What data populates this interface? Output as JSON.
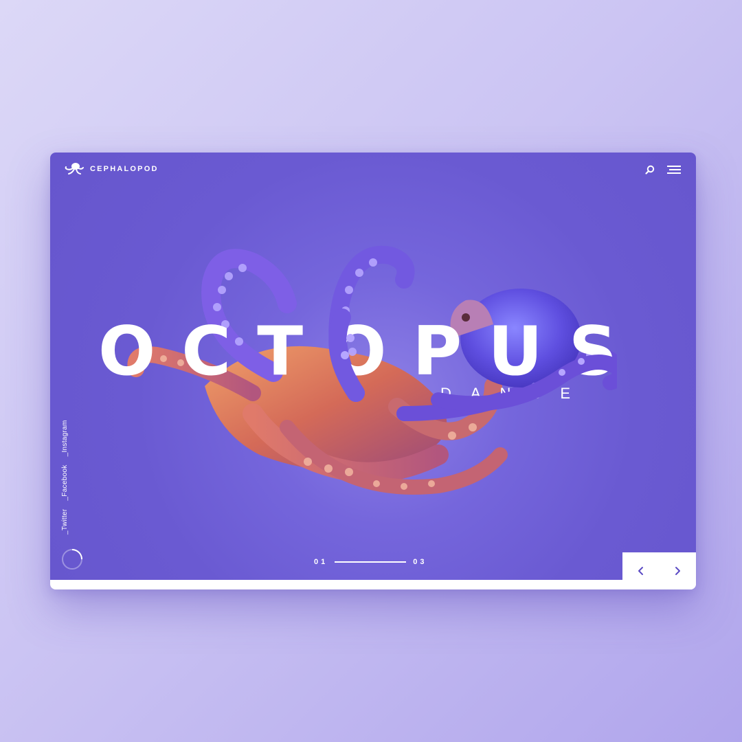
{
  "brand": {
    "name": "CEPHALOPOD",
    "logo_icon": "octopus-logo-icon"
  },
  "header": {
    "search_icon": "search-icon",
    "menu_icon": "hamburger-menu-icon"
  },
  "hero": {
    "title": "OCTOPUS",
    "subtitle": "DANCE"
  },
  "social": {
    "links": [
      "_Twitter",
      "_Facebook",
      "_Instagram"
    ]
  },
  "pager": {
    "current": "01",
    "total": "03"
  },
  "nav": {
    "prev_icon": "chevron-left-icon",
    "next_icon": "chevron-right-icon"
  },
  "colors": {
    "page_bg": "#cfc8f4",
    "hero_bg": "#6a5ad2",
    "accent": "#ffffff",
    "nav_arrow": "#5b4bc4"
  }
}
